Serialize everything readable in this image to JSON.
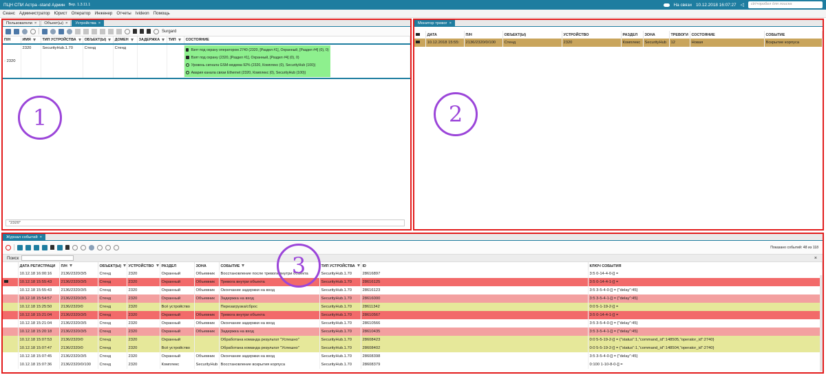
{
  "titlebar": {
    "app": "ПЦН СПИ Астра -stand Админ",
    "version": "Вер. 1.3.11.1",
    "status": "На связи",
    "datetime": "10.12.2018 16:07:27",
    "search_placeholder": "ctrl+пробел для поиска"
  },
  "menu": [
    "Сеанс",
    "Администратор",
    "Юрист",
    "Оператор",
    "Инженер",
    "Отчеты",
    "Ivideon",
    "Помощь"
  ],
  "panel1": {
    "tabs": [
      {
        "label": "Пользователи",
        "active": false
      },
      {
        "label": "Объект(ы)",
        "active": false
      },
      {
        "label": "Устройства",
        "active": true
      }
    ],
    "toolbar_label": "Surgard",
    "columns": [
      "П/Н",
      "ИМЯ",
      "ТИП УСТРОЙСТВА",
      "ОБЪЕКТ(Ы)",
      "ДОМЕН",
      "ЗАДЕРЖКА",
      "ТИП",
      "СОСТОЯНИЕ"
    ],
    "row": {
      "pn": "2320",
      "name": "2320",
      "type": "SecurityHub.1.70",
      "object": "Стенд",
      "domain": "Стенд",
      "states": [
        {
          "icon": "lock-icon",
          "text": "Взят под охрану оператором 2740 (2320, [Раздел #1], Охранный, [Раздел #4] (0), 0)"
        },
        {
          "icon": "lock-icon",
          "text": "Взят под охрану (2320, [Раздел #1], Охранный, [Раздел #4] (0), 0)"
        },
        {
          "icon": "network-icon",
          "text": "Уровень сигнала GSM-модема 92% (2320, Комплекс (0), SecurityHub (100))"
        },
        {
          "icon": "network-icon",
          "text": "Авария канала связи Ethernet (2320, Комплекс (0), SecurityHub (100))"
        }
      ]
    },
    "footer_filter": "\"2320\"",
    "annotation": "1"
  },
  "panel2": {
    "tab": "Монитор тревог",
    "columns": [
      "ДАТА",
      "П/Н",
      "ОБЪЕКТ(Ы)",
      "УСТРОЙСТВО",
      "РАЗДЕЛ",
      "ЗОНА",
      "ТРЕВОГИ",
      "СОСТОЯНИЕ",
      "СОБЫТИЕ"
    ],
    "row": [
      "10.12.2018 15:55:",
      "2136/2320/0/100",
      "Стенд",
      "2320",
      "Комплекс",
      "SecurityHub",
      "12",
      "Новая",
      "Вскрытие корпуса"
    ],
    "annotation": "2"
  },
  "panel3": {
    "tab": "Журнал событий",
    "shown_events": "Показано событий: 48 из 118",
    "search_label": "Поиск",
    "columns": [
      "ДАТА РЕГИСТРАЦИ",
      "П/Н",
      "ОБЪЕКТ(Ы)",
      "УСТРОЙСТВО",
      "РАЗДЕЛ",
      "ЗОНА",
      "СОБЫТИЕ",
      "ТИП УСТРОЙСТВА",
      "ID",
      "КЛЮЧ СОБЫТИЯ"
    ],
    "rows": [
      {
        "color": "white",
        "cells": [
          "10.12.18 16:00:16",
          "2136/2320/3/5",
          "Стенд",
          "2320",
          "Охранный",
          "Объемник",
          "Восстановление после тревоги внутри объекта",
          "SecurityHub.1.70",
          "28616897",
          "3:5 0-14-4-0-[] ="
        ]
      },
      {
        "color": "red",
        "cells": [
          "10.12.18 15:55:43",
          "2136/2320/3/5",
          "Стенд",
          "2320",
          "Охранный",
          "Объемник",
          "Тревога внутри объекта",
          "SecurityHub.1.70",
          "28616125",
          "3:5 0-14-4-1-[] ="
        ]
      },
      {
        "color": "white",
        "cells": [
          "10.12.18 15:55:43",
          "2136/2320/3/5",
          "Стенд",
          "2320",
          "Охранный",
          "Объемник",
          "Окончание задержки на вход",
          "SecurityHub.1.70",
          "28616123",
          "3:5 3-5-4-0-[] = {\"delay\":45}"
        ]
      },
      {
        "color": "pink",
        "cells": [
          "10.12.18 15:54:57",
          "2136/2320/3/5",
          "Стенд",
          "2320",
          "Охранный",
          "Объемник",
          "Задержка на вход",
          "SecurityHub.1.70",
          "28616000",
          "3:5 3-5-4-1-[] = {\"delay\":45}"
        ]
      },
      {
        "color": "yellow",
        "cells": [
          "10.12.18 15:25:50",
          "2136/2320/0",
          "Стенд",
          "2320",
          "Всё устройство",
          "",
          "Перезагрузка/сброс",
          "SecurityHub.1.70",
          "28611342",
          "0:0 5-1-19-2-[] ="
        ]
      },
      {
        "color": "red",
        "cells": [
          "10.12.18 15:21:04",
          "2136/2320/3/5",
          "Стенд",
          "2320",
          "Охранный",
          "Объемник",
          "Тревога внутри объекта",
          "SecurityHub.1.70",
          "28610567",
          "3:5 0-14-4-1-[] ="
        ]
      },
      {
        "color": "white",
        "cells": [
          "10.12.18 15:21:04",
          "2136/2320/3/5",
          "Стенд",
          "2320",
          "Охранный",
          "Объемник",
          "Окончание задержки на вход",
          "SecurityHub.1.70",
          "28610566",
          "3:5 3-5-4-0-[] = {\"delay\":45}"
        ]
      },
      {
        "color": "pink",
        "cells": [
          "10.12.18 15:20:18",
          "2136/2320/3/5",
          "Стенд",
          "2320",
          "Охранный",
          "Объемник",
          "Задержка на вход",
          "SecurityHub.1.70",
          "28610435",
          "3:5 3-5-4-1-[] = {\"delay\":45}"
        ]
      },
      {
        "color": "yellow",
        "cells": [
          "10.12.18 15:07:53",
          "2136/2320/0",
          "Стенд",
          "2320",
          "Охранный",
          "",
          "Обработана команда результат \"Успешно\"",
          "SecurityHub.1.70",
          "28608423",
          "0:0 5-5-19-2-[] = {\"status\":1,\"command_id\":148505,\"operator_id\":2740}"
        ]
      },
      {
        "color": "yellow",
        "cells": [
          "10.12.18 15:07:47",
          "2136/2320/0",
          "Стенд",
          "2320",
          "Всё устройство",
          "",
          "Обработана команда результат \"Успешно\"",
          "SecurityHub.1.70",
          "28608402",
          "0:0 5-5-19-2-[] = {\"status\":1,\"command_id\":148504,\"operator_id\":2740}"
        ]
      },
      {
        "color": "white",
        "cells": [
          "10.12.18 15:07:45",
          "2136/2320/3/5",
          "Стенд",
          "2320",
          "Охранный",
          "Объемник",
          "Окончание задержки на вход",
          "SecurityHub.1.70",
          "28608398",
          "3:5 3-5-4-0-[] = {\"delay\":45}"
        ]
      },
      {
        "color": "white",
        "cells": [
          "10.12.18 15:07:36",
          "2136/2320/0/100",
          "Стенд",
          "2320",
          "Комплекс",
          "SecurityHub",
          "Восстановление вскрытия корпуса",
          "SecurityHub.1.70",
          "28608379",
          "0:100 1-10-8-0-[] ="
        ]
      }
    ],
    "annotation": "3"
  },
  "colors": {
    "accent": "#1e7da0",
    "frame": "#e21b1b",
    "annotation": "#9b45d9",
    "alarm_red": "#f26a6a",
    "alarm_pink": "#f3a0a0",
    "info_yellow": "#e6e89a",
    "alarm_gold": "#c9a55c",
    "state_green": "#8ef08e"
  }
}
